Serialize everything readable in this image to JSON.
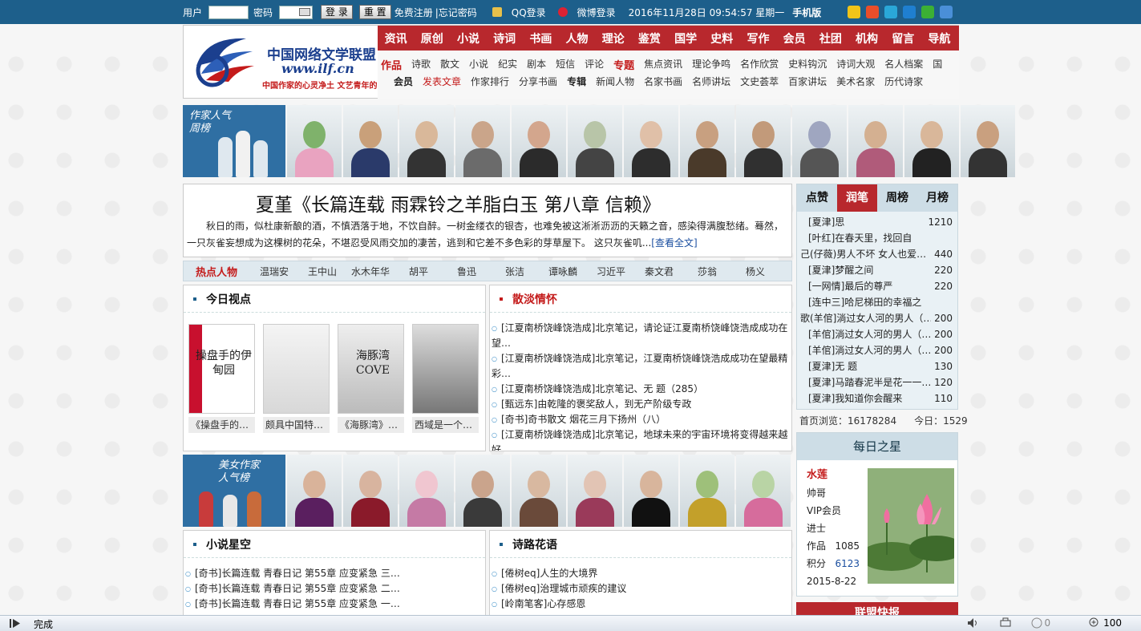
{
  "topbar": {
    "user_label": "用户",
    "pwd_label": "密码",
    "login_btn": "登 录",
    "reset_btn": "重 置",
    "register_link": "免费注册",
    "forgot_link": "|忘记密码",
    "qq_login": "QQ登录",
    "weibo_login": "微博登录",
    "datetime": "2016年11月28日  09:54:57  星期一",
    "mobile": "手机版",
    "share_icons": [
      "favorite-icon",
      "rss-icon",
      "qzone-icon",
      "renren-icon",
      "wechat-icon",
      "plus-icon"
    ]
  },
  "header": {
    "logo_cn": "中国网络文学联盟",
    "logo_url": "www.ilf.cn",
    "logo_slogan": "中国作家的心灵净土 文艺青年的网上家园",
    "main_nav": [
      "资讯",
      "原创",
      "小说",
      "诗词",
      "书画",
      "人物",
      "理论",
      "鉴赏",
      "国学",
      "史料",
      "写作",
      "会员",
      "社团",
      "机构",
      "留言",
      "导航"
    ],
    "sub_row1": {
      "head": "作品",
      "items": [
        "诗歌",
        "散文",
        "小说",
        "纪实",
        "剧本",
        "短信",
        "评论"
      ],
      "head2": "专题",
      "items2": [
        "焦点资讯",
        "理论争鸣",
        "名作欣赏",
        "史料钩沉",
        "诗词大观",
        "名人档案",
        "国"
      ]
    },
    "sub_row2": {
      "head": "会员",
      "red_link": "发表文章",
      "items": [
        "作家排行",
        "分享书画"
      ],
      "head2": "专辑",
      "items2": [
        "新闻人物",
        "名家书画",
        "名师讲坛",
        "文史荟萃",
        "百家讲坛",
        "美术名家",
        "历代诗家"
      ]
    }
  },
  "strip1": {
    "banner_text": "作家人气\n周榜"
  },
  "strip2": {
    "banner_text": "美女作家\n人气榜"
  },
  "feature": {
    "title": "夏堇《长篇连载  雨霖铃之羊脂白玉  第八章  信赖》",
    "body": "秋日的雨，似杜康新酿的酒，不慎洒落于地，不饮自醉。一树金缕衣的银杏，也难免被这淅淅沥沥的天籁之音，感染得满腹愁绪。蓦然，一只灰雀妄想成为这棵树的花朵，不堪忍受风雨交加的凄苦，逃到和它差不多色彩的芽草屋下。  这只灰雀叽...",
    "more": "[查看全文]"
  },
  "hot": {
    "title": "热点人物",
    "people": [
      "温瑞安",
      "王中山",
      "水木年华",
      "胡平",
      "鲁迅",
      "张洁",
      "谭咏麟",
      "习近平",
      "秦文君",
      "莎翁",
      "杨义"
    ]
  },
  "today": {
    "title": "今日视点",
    "books": [
      "《操盘手的…",
      "颇具中国特…",
      "《海豚湾》…",
      "西域是一个…"
    ],
    "cover_texts": [
      "操盘手的伊甸园",
      "",
      "海豚湾 COVE",
      ""
    ]
  },
  "prose": {
    "title": "散淡情怀",
    "items": [
      "[江夏南桥饶峰饶浩成]北京笔记，请论证江夏南桥饶峰饶浩成成功在望…",
      "[江夏南桥饶峰饶浩成]北京笔记，江夏南桥饶峰饶浩成成功在望最精彩…",
      "[江夏南桥饶峰饶浩成]北京笔记、无  题（285）",
      "[甄远东]由乾隆的褒奖敌人，到无产阶级专政",
      "[奇书]奇书散文  烟花三月下扬州（八）",
      "[江夏南桥饶峰饶浩成]北京笔记，地球未来的宇宙环境将变得越来越好…"
    ]
  },
  "novel": {
    "title": "小说星空",
    "items": [
      "[奇书]长篇连载  青春日记  第55章  应变紧急  三…",
      "[奇书]长篇连载  青春日记  第55章  应变紧急  二…",
      "[奇书]长篇连载  青春日记  第55章  应变紧急  一…"
    ]
  },
  "poetry": {
    "title": "诗路花语",
    "items": [
      "[倦树eq]人生的大境界",
      "[倦树eq]治理城市顽疾的建议",
      "[岭南笔客]心存感恩"
    ]
  },
  "rank": {
    "tabs": [
      "点赞",
      "润笔",
      "周榜",
      "月榜"
    ],
    "active": 1,
    "items": [
      {
        "t": "[夏津]思",
        "n": "1210",
        "ind": false
      },
      {
        "t": "[叶红]在春天里，找回自",
        "n": "",
        "ind": false
      },
      {
        "t": "己(仔薇)男人不坏  女人也爱…",
        "n": "440",
        "ind": true
      },
      {
        "t": "[夏津]梦醒之间",
        "n": "220",
        "ind": false
      },
      {
        "t": "[一网情]最后的尊严",
        "n": "220",
        "ind": false
      },
      {
        "t": "[连中三]哈尼梯田的幸福之",
        "n": "",
        "ind": false
      },
      {
        "t": "歌(羊倌]淌过女人河的男人（…",
        "n": "200",
        "ind": true
      },
      {
        "t": "[羊倌]淌过女人河的男人（…",
        "n": "200",
        "ind": false
      },
      {
        "t": "[羊倌]淌过女人河的男人（…",
        "n": "200",
        "ind": false
      },
      {
        "t": "[夏津]无  题",
        "n": "130",
        "ind": false
      },
      {
        "t": "[夏津]马踏春泥半是花一一…",
        "n": "120",
        "ind": false
      },
      {
        "t": "[夏津]我知道你会醒来",
        "n": "110",
        "ind": false
      }
    ]
  },
  "stats": {
    "home_views": "首页浏览：16178284",
    "today": "今日：1529"
  },
  "daystar": {
    "title": "每日之星",
    "name": "水莲",
    "lines": [
      "帅哥",
      "VIP会员",
      "进士"
    ],
    "works_label": "作品",
    "works": "1085",
    "points_label": "积分",
    "points": "6123",
    "date": "2015-8-22"
  },
  "bottom_section": "联盟快报",
  "statusbar": {
    "text": "完成",
    "count": "0",
    "zoom": "100"
  },
  "colors": {
    "topbar": "#1d5f8b",
    "nav_red": "#b8282d",
    "accent_red": "#c41b1b",
    "link_blue": "#1b4fa0"
  }
}
